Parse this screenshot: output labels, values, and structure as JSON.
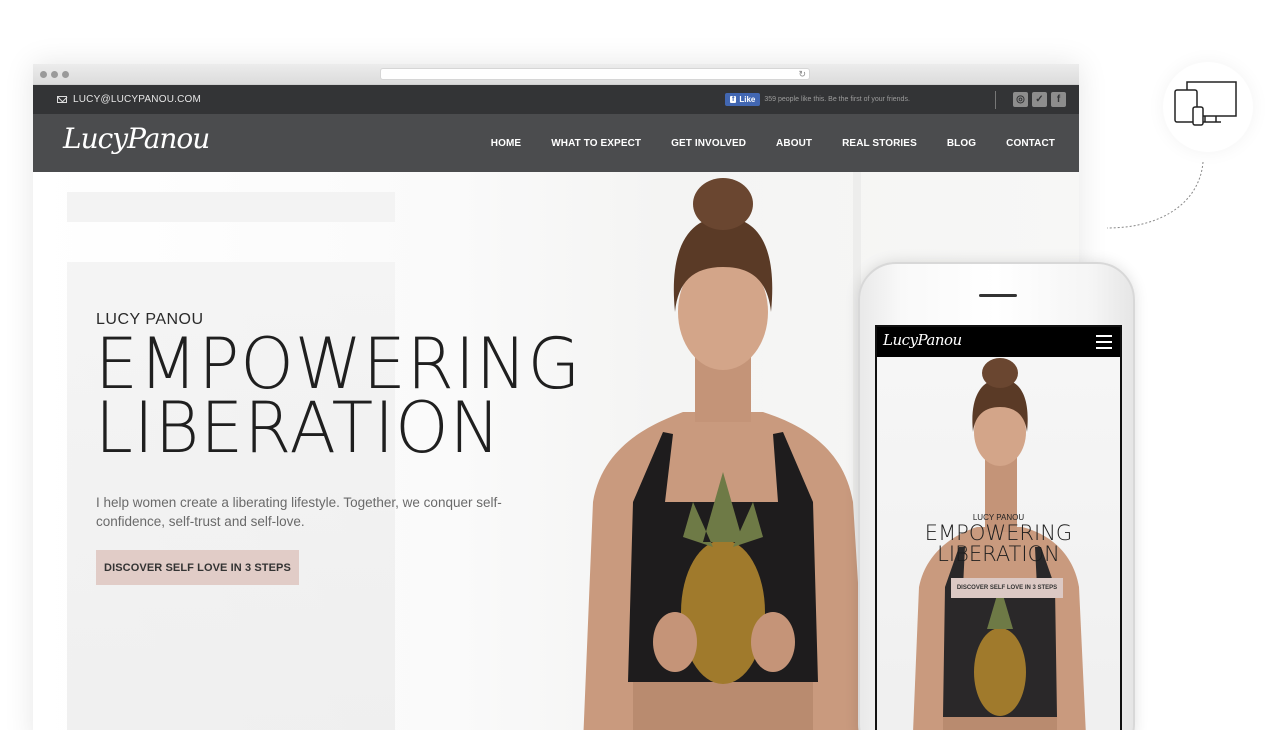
{
  "topbar": {
    "email": "LUCY@LUCYPANOU.COM",
    "fb_like_label": "Like",
    "fb_text": "359 people like this. Be the first of your friends.",
    "socials": [
      "instagram-icon",
      "twitter-icon",
      "facebook-icon"
    ]
  },
  "nav": {
    "logo": "LucyPanou",
    "items": [
      "HOME",
      "WHAT TO EXPECT",
      "GET INVOLVED",
      "ABOUT",
      "REAL STORIES",
      "BLOG",
      "CONTACT"
    ]
  },
  "hero": {
    "kicker": "LUCY PANOU",
    "headline_1": "EMPOWERING",
    "headline_2": "LIBERATION",
    "subtitle": "I help women create a liberating lifestyle. Together, we conquer self-confidence, self-trust and self-love.",
    "cta": "DISCOVER SELF LOVE IN 3 STEPS"
  },
  "mobile": {
    "logo": "LucyPanou",
    "kicker": "LUCY PANOU",
    "headline_1": "EMPOWERING",
    "headline_2": "LIBERATION",
    "cta": "DISCOVER SELF LOVE IN 3 STEPS"
  },
  "colors": {
    "topbar": "#333436",
    "navbar": "#4b4c4e",
    "cta": "#e1ccc7",
    "fb": "#4267b2"
  }
}
